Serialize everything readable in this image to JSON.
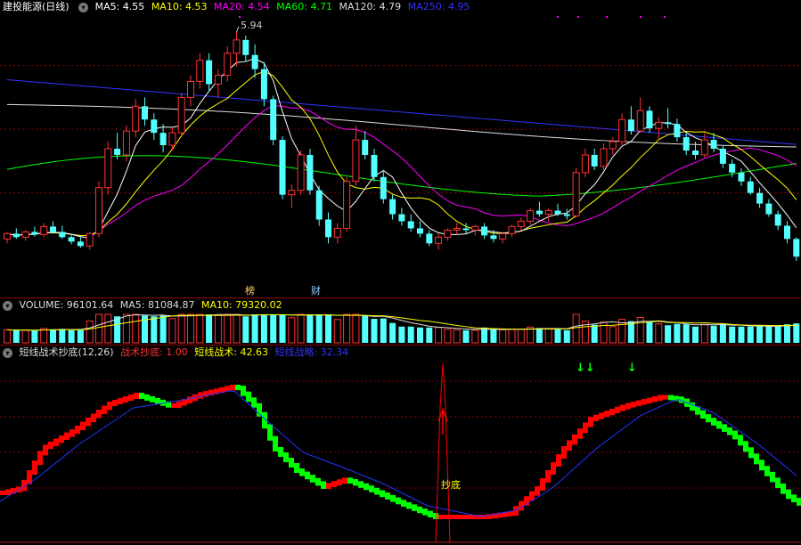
{
  "colors": {
    "up": "#ff3333",
    "down": "#54ffff",
    "ma5": "#ffffff",
    "ma10": "#ffff00",
    "ma20": "#ff00ff",
    "ma60": "#00ff00",
    "ma120": "#dddddd",
    "ma250": "#3333ff",
    "grid": "#8b0000",
    "zs": "#ff0000",
    "zz": "#00ff00",
    "zl": "#2233ff"
  },
  "price_pane": {
    "title": "建投能源(日线)",
    "ma": [
      {
        "label": "MA5: 4.55",
        "color": "#ffffff"
      },
      {
        "label": "MA10: 4.53",
        "color": "#ffff00"
      },
      {
        "label": "MA20: 4.54",
        "color": "#ff00ff"
      },
      {
        "label": "MA60: 4.71",
        "color": "#00ff00"
      },
      {
        "label": "MA120: 4.79",
        "color": "#dddddd"
      },
      {
        "label": "MA250: 4.95",
        "color": "#3333ff"
      }
    ],
    "high_label": "5.94",
    "markers": [
      {
        "text": "榜",
        "color": "#ffcc66"
      },
      {
        "text": "财",
        "color": "#88ccff"
      }
    ]
  },
  "volume_pane": {
    "items": [
      {
        "label": "VOLUME: 96101.64",
        "color": "#dddddd"
      },
      {
        "label": "MA5: 81084.87",
        "color": "#dddddd"
      },
      {
        "label": "MA10: 79320.02",
        "color": "#ffff00"
      }
    ]
  },
  "indicator_pane": {
    "title": "短线战术抄底(12,26)",
    "items": [
      {
        "label": "战术抄底: 1.00",
        "color": "#ff3333"
      },
      {
        "label": "短线战术: 42.63",
        "color": "#ffff00"
      },
      {
        "label": "短线战略: 32.34",
        "color": "#3333ff"
      }
    ],
    "signal_label": "抄底",
    "arrows": [
      "↓↓",
      "↓"
    ]
  },
  "chart_data": {
    "type": "candlestick",
    "price_ylim": [
      3.1,
      6.1
    ],
    "candles": [
      [
        3.6,
        3.68,
        3.55,
        3.66
      ],
      [
        3.66,
        3.72,
        3.6,
        3.62
      ],
      [
        3.62,
        3.7,
        3.58,
        3.68
      ],
      [
        3.68,
        3.74,
        3.63,
        3.65
      ],
      [
        3.65,
        3.78,
        3.62,
        3.74
      ],
      [
        3.74,
        3.8,
        3.66,
        3.68
      ],
      [
        3.68,
        3.75,
        3.6,
        3.62
      ],
      [
        3.62,
        3.66,
        3.54,
        3.57
      ],
      [
        3.57,
        3.62,
        3.5,
        3.52
      ],
      [
        3.52,
        3.68,
        3.48,
        3.66
      ],
      [
        3.66,
        4.25,
        3.62,
        4.18
      ],
      [
        4.18,
        4.7,
        4.1,
        4.62
      ],
      [
        4.62,
        4.8,
        4.5,
        4.55
      ],
      [
        4.55,
        4.88,
        4.48,
        4.82
      ],
      [
        4.82,
        5.18,
        4.75,
        5.1
      ],
      [
        5.1,
        5.2,
        4.88,
        4.95
      ],
      [
        4.95,
        5.02,
        4.72,
        4.8
      ],
      [
        4.8,
        4.9,
        4.58,
        4.66
      ],
      [
        4.66,
        4.85,
        4.6,
        4.8
      ],
      [
        4.8,
        5.25,
        4.75,
        5.2
      ],
      [
        5.2,
        5.45,
        5.1,
        5.38
      ],
      [
        5.38,
        5.7,
        5.3,
        5.62
      ],
      [
        5.62,
        5.7,
        5.28,
        5.35
      ],
      [
        5.35,
        5.52,
        5.2,
        5.45
      ],
      [
        5.45,
        5.78,
        5.38,
        5.7
      ],
      [
        5.7,
        5.94,
        5.55,
        5.85
      ],
      [
        5.85,
        5.9,
        5.6,
        5.68
      ],
      [
        5.68,
        5.8,
        5.42,
        5.52
      ],
      [
        5.52,
        5.6,
        5.1,
        5.18
      ],
      [
        5.18,
        5.22,
        4.66,
        4.72
      ],
      [
        4.72,
        4.76,
        4.05,
        4.1
      ],
      [
        4.1,
        4.22,
        3.95,
        4.15
      ],
      [
        4.15,
        4.6,
        4.1,
        4.55
      ],
      [
        4.55,
        4.62,
        4.1,
        4.15
      ],
      [
        4.15,
        4.2,
        3.75,
        3.82
      ],
      [
        3.82,
        3.9,
        3.55,
        3.62
      ],
      [
        3.62,
        3.78,
        3.55,
        3.72
      ],
      [
        3.72,
        4.3,
        3.68,
        4.25
      ],
      [
        4.25,
        4.88,
        4.2,
        4.72
      ],
      [
        4.72,
        4.82,
        4.5,
        4.55
      ],
      [
        4.55,
        4.62,
        4.25,
        4.3
      ],
      [
        4.3,
        4.38,
        4.0,
        4.05
      ],
      [
        4.05,
        4.1,
        3.82,
        3.88
      ],
      [
        3.88,
        3.95,
        3.75,
        3.8
      ],
      [
        3.8,
        3.88,
        3.68,
        3.72
      ],
      [
        3.72,
        3.8,
        3.62,
        3.66
      ],
      [
        3.66,
        3.7,
        3.52,
        3.55
      ],
      [
        3.55,
        3.66,
        3.48,
        3.62
      ],
      [
        3.62,
        3.72,
        3.58,
        3.7
      ],
      [
        3.7,
        3.78,
        3.65,
        3.72
      ],
      [
        3.72,
        3.78,
        3.66,
        3.7
      ],
      [
        3.7,
        3.76,
        3.64,
        3.74
      ],
      [
        3.74,
        3.78,
        3.6,
        3.64
      ],
      [
        3.64,
        3.7,
        3.56,
        3.6
      ],
      [
        3.6,
        3.68,
        3.55,
        3.66
      ],
      [
        3.66,
        3.76,
        3.62,
        3.74
      ],
      [
        3.74,
        3.84,
        3.7,
        3.8
      ],
      [
        3.8,
        3.95,
        3.76,
        3.92
      ],
      [
        3.92,
        4.02,
        3.85,
        3.88
      ],
      [
        3.88,
        3.95,
        3.8,
        3.92
      ],
      [
        3.92,
        4.0,
        3.86,
        3.88
      ],
      [
        3.88,
        3.94,
        3.82,
        3.86
      ],
      [
        3.86,
        4.4,
        3.84,
        4.35
      ],
      [
        4.35,
        4.62,
        4.3,
        4.55
      ],
      [
        4.55,
        4.62,
        4.38,
        4.42
      ],
      [
        4.42,
        4.68,
        4.38,
        4.62
      ],
      [
        4.62,
        4.75,
        4.55,
        4.7
      ],
      [
        4.7,
        5.02,
        4.66,
        4.95
      ],
      [
        4.95,
        5.1,
        4.78,
        4.82
      ],
      [
        4.82,
        5.2,
        4.8,
        5.05
      ],
      [
        5.05,
        5.1,
        4.8,
        4.85
      ],
      [
        4.85,
        4.98,
        4.72,
        4.92
      ],
      [
        4.92,
        5.08,
        4.85,
        4.9
      ],
      [
        4.9,
        4.96,
        4.7,
        4.75
      ],
      [
        4.75,
        4.8,
        4.55,
        4.6
      ],
      [
        4.6,
        4.7,
        4.5,
        4.55
      ],
      [
        4.55,
        4.8,
        4.52,
        4.72
      ],
      [
        4.72,
        4.8,
        4.58,
        4.62
      ],
      [
        4.62,
        4.66,
        4.4,
        4.45
      ],
      [
        4.45,
        4.5,
        4.3,
        4.35
      ],
      [
        4.35,
        4.4,
        4.2,
        4.25
      ],
      [
        4.25,
        4.3,
        4.1,
        4.12
      ],
      [
        4.12,
        4.18,
        3.95,
        4.0
      ],
      [
        4.0,
        4.05,
        3.85,
        3.88
      ],
      [
        3.88,
        3.92,
        3.7,
        3.75
      ],
      [
        3.75,
        3.8,
        3.55,
        3.6
      ],
      [
        3.6,
        3.62,
        3.35,
        3.4
      ]
    ],
    "indicator": {
      "zs_peak": 1.0
    }
  }
}
